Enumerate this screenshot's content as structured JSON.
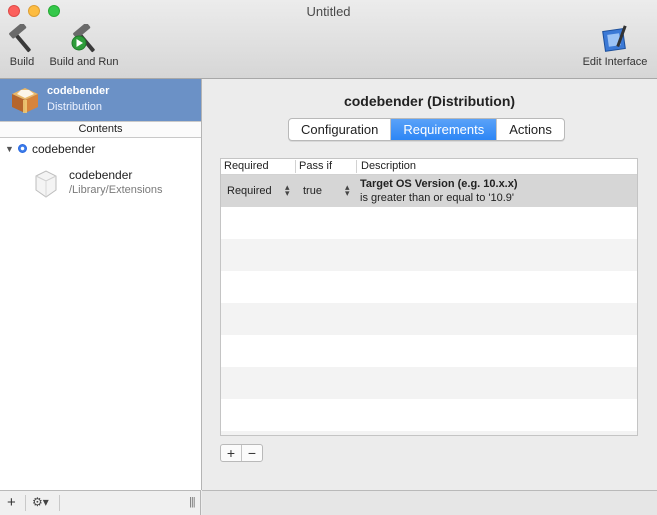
{
  "window": {
    "title": "Untitled"
  },
  "toolbar": {
    "build_label": "Build",
    "build_run_label": "Build and Run",
    "edit_interface_label": "Edit Interface"
  },
  "sidebar": {
    "project_name": "codebender",
    "project_subtitle": "Distribution",
    "contents_header": "Contents",
    "tree_root": "codebender",
    "child_name": "codebender",
    "child_path": "/Library/Extensions"
  },
  "main": {
    "title": "codebender (Distribution)",
    "tabs": [
      {
        "label": "Configuration",
        "active": false
      },
      {
        "label": "Requirements",
        "active": true
      },
      {
        "label": "Actions",
        "active": false
      }
    ],
    "table": {
      "columns": [
        "Required",
        "Pass if",
        "Description"
      ],
      "rows": [
        {
          "required": "Required",
          "pass_if": "true",
          "description_title": "Target OS Version (e.g. 10.x.x)",
          "description_detail": "is greater than or equal to '10.9'"
        }
      ]
    },
    "add_label": "+",
    "remove_label": "−"
  },
  "colors": {
    "selection": "#6b91c6",
    "segment_active": "#2d86f5",
    "row_selected": "#d6d6d6"
  }
}
